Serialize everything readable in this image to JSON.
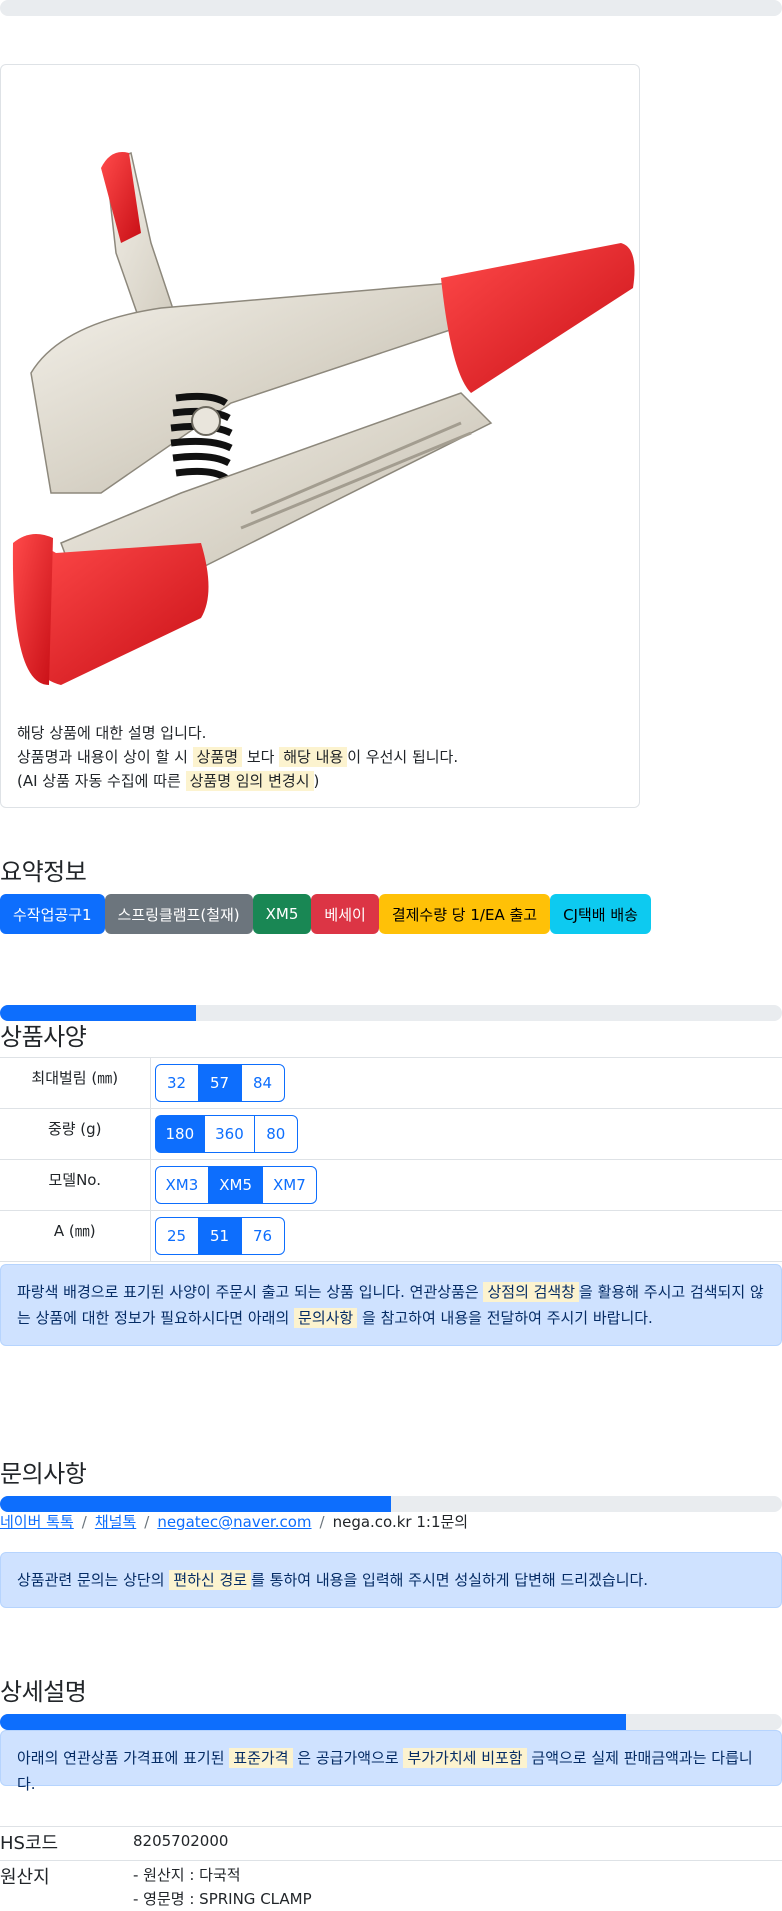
{
  "card": {
    "line1": "해당 상품에 대한 설명 입니다.",
    "line2_a": "상품명과 내용이 상이 할 시",
    "line2_mark1": "상품명",
    "line2_b": "보다",
    "line2_mark2": "해당 내용",
    "line2_c": "이 우선시 됩니다.",
    "line3_a": "(AI 상품 자동 수집에 따른",
    "line3_mark": "상품명 임의 변경시",
    "line3_b": ")"
  },
  "summary": {
    "title": "요약정보",
    "badges": [
      {
        "label": "수작업공구1",
        "bg": "#0d6efd",
        "fg": "#ffffff"
      },
      {
        "label": "스프링클램프(철재)",
        "bg": "#6c757d",
        "fg": "#ffffff"
      },
      {
        "label": "XM5",
        "bg": "#198754",
        "fg": "#ffffff"
      },
      {
        "label": "베세이",
        "bg": "#dc3545",
        "fg": "#ffffff"
      },
      {
        "label": "결제수량 당 1/EA 출고",
        "bg": "#ffc107",
        "fg": "#000000"
      },
      {
        "label": "CJ택배 배송",
        "bg": "#0dcaf0",
        "fg": "#000000"
      }
    ]
  },
  "specs": {
    "title": "상품사양",
    "progress": 0.25,
    "rows": [
      {
        "label": "최대벌림 (㎜)",
        "options": [
          "32",
          "57",
          "84"
        ],
        "selected": "57"
      },
      {
        "label": "중량 (g)",
        "options": [
          "180",
          "360",
          "80"
        ],
        "selected": "180"
      },
      {
        "label": "모델No.",
        "options": [
          "XM3",
          "XM5",
          "XM7"
        ],
        "selected": "XM5"
      },
      {
        "label": "A (㎜)",
        "options": [
          "25",
          "51",
          "76"
        ],
        "selected": "51"
      }
    ],
    "alert_a": "파랑색 배경으로 표기된 사양이 주문시 출고 되는 상품 입니다. 연관상품은",
    "alert_mark1": "상점의 검색창",
    "alert_b": "을 활용해 주시고 검색되지 않는 상품에 대한 정보가 필요하시다면 아래의",
    "alert_mark2": "문의사항",
    "alert_c": "을 참고하여 내용을 전달하여 주시기 바랍니다."
  },
  "inquiry": {
    "title": "문의사항",
    "progress": 0.5,
    "link1": "네이버 톡톡",
    "link2": "채널톡",
    "link3": "negatec@naver.com",
    "text4": "nega.co.kr 1:1문의",
    "separator": "/",
    "alert_a": "상품관련 문의는 상단의",
    "alert_mark": "편하신 경로",
    "alert_b": "를 통하여 내용을 입력해 주시면 성실하게 답변해 드리겠습니다."
  },
  "detail": {
    "title": "상세설명",
    "progress": 0.8,
    "alert_a": "아래의 연관상품 가격표에 표기된",
    "alert_mark1": "표준가격",
    "alert_b": "은 공급가액으로",
    "alert_mark2": "부가가치세 비포함",
    "alert_c": "금액으로 실제 판매금액과는 다릅니다.",
    "hs_label": "HS코드",
    "hs_value": "8205702000",
    "origin_label": "원산지",
    "origin_line1": "- 원산지 : 다국적",
    "origin_line2": "- 영문명 : SPRING CLAMP"
  }
}
